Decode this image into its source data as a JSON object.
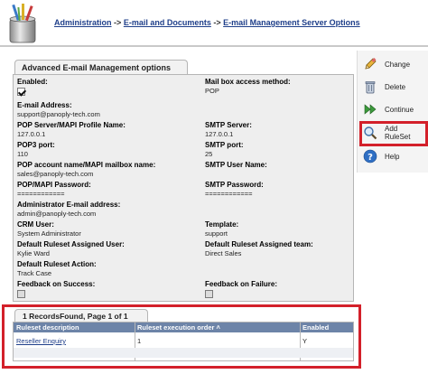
{
  "breadcrumb": {
    "items": [
      "Administration",
      "E-mail and Documents",
      "E-mail Management Server Options"
    ],
    "separator": "->"
  },
  "panel": {
    "title": "Advanced E-mail Management options",
    "fields": {
      "enabled": {
        "label": "Enabled:",
        "checked": true
      },
      "mailbox_access": {
        "label": "Mail box access method:",
        "value": "POP"
      },
      "email_address": {
        "label": "E-mail Address:",
        "value": "support@panoply-tech.com"
      },
      "pop_server": {
        "label": "POP Server/MAPI Profile Name:",
        "value": "127.0.0.1"
      },
      "smtp_server": {
        "label": "SMTP Server:",
        "value": "127.0.0.1"
      },
      "pop3_port": {
        "label": "POP3 port:",
        "value": "110"
      },
      "smtp_port": {
        "label": "SMTP port:",
        "value": "25"
      },
      "pop_account": {
        "label": "POP account name/MAPI mailbox name:",
        "value": "sales@panoply-tech.com"
      },
      "smtp_user": {
        "label": "SMTP User Name:",
        "value": ""
      },
      "pop_password": {
        "label": "POP/MAPI Password:",
        "value": "============"
      },
      "smtp_password": {
        "label": "SMTP Password:",
        "value": "============"
      },
      "admin_email": {
        "label": "Administrator E-mail address:",
        "value": "admin@panoply-tech.com"
      },
      "crm_user": {
        "label": "CRM User:",
        "value": "System Administrator"
      },
      "template": {
        "label": "Template:",
        "value": "support"
      },
      "default_ruleset_user": {
        "label": "Default Ruleset Assigned User:",
        "value": "Kylie Ward"
      },
      "default_ruleset_team": {
        "label": "Default Ruleset Assigned team:",
        "value": "Direct Sales"
      },
      "default_ruleset_action": {
        "label": "Default Ruleset Action:",
        "value": "Track Case"
      },
      "feedback_success": {
        "label": "Feedback on Success:",
        "checked": false
      },
      "feedback_failure": {
        "label": "Feedback on Failure:",
        "checked": false
      }
    }
  },
  "actions": {
    "change": "Change",
    "delete": "Delete",
    "continue": "Continue",
    "add_ruleset": "Add RuleSet",
    "help": "Help"
  },
  "records": {
    "title": "1 RecordsFound, Page 1 of 1",
    "columns": [
      "Ruleset description",
      "Ruleset execution order ˄",
      "Enabled"
    ],
    "rows": [
      {
        "description": "Reseller Enquiry",
        "order": "1",
        "enabled": "Y"
      }
    ]
  },
  "colors": {
    "highlight": "#d3202a",
    "grid_header": "#6d84a8",
    "link": "#1f3f8a"
  }
}
